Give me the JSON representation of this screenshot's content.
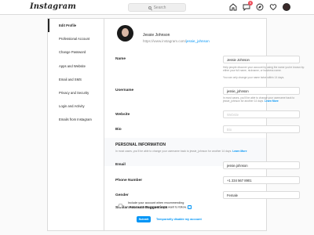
{
  "header": {
    "logo": "Instagram",
    "search_placeholder": "Search",
    "icons": [
      "home-icon",
      "messages-icon",
      "explore-icon",
      "heart-icon",
      "avatar"
    ],
    "message_badge": "5"
  },
  "sidebar": {
    "items": [
      {
        "label": "Edit Profile",
        "active": true
      },
      {
        "label": "Professional Account"
      },
      {
        "label": "Change Password"
      },
      {
        "label": "Apps and Website"
      },
      {
        "label": "Email and SMS"
      },
      {
        "label": "Privacy and Security"
      },
      {
        "label": "Login and Activity"
      },
      {
        "label": "Emails from Instagram"
      }
    ]
  },
  "profile": {
    "name": "Jessie Johnson",
    "url_prefix": "https://www.instagram.com/",
    "url_handle": "jessie_johnson"
  },
  "form": {
    "name": {
      "label": "Name",
      "value": "Jessie Johnson",
      "help1": "Help people discover your account by using the name you're known by: either your full name, nickname, or business name.",
      "help2": "You can only change your name twice within 14 days."
    },
    "username": {
      "label": "Username",
      "value": "jessie_johnson",
      "help": "In most cases, you'll be able to change your username back to jessie_johnson for another 14 days.",
      "help_link": "Learn More"
    },
    "website": {
      "label": "Website",
      "placeholder": "Website"
    },
    "bio": {
      "label": "Bio",
      "placeholder": "Bio"
    }
  },
  "personal": {
    "title": "PERSONAL INFORMATION",
    "help": "In most cases, you'll be able to change your username back to jessie_johnson for another 14 days.",
    "help_link": "Learn More",
    "email": {
      "label": "Email",
      "value": "jessie.johnson"
    },
    "phone": {
      "label": "Phone Number",
      "value": "+1 234 567 8901"
    },
    "gender": {
      "label": "Gender",
      "value": "Female"
    },
    "suggestions": {
      "label": "Similar Account Suggestions",
      "text": "Include your account when recommending similar accounts people might want to follow.",
      "help_icon": "?",
      "checked": false
    }
  },
  "actions": {
    "submit": "Submit",
    "disable": "Temporarily disable my account"
  },
  "colors": {
    "accent": "#0095f6",
    "badge": "#ed4956",
    "border": "#dbdbdb",
    "muted": "#8e8e8e"
  }
}
